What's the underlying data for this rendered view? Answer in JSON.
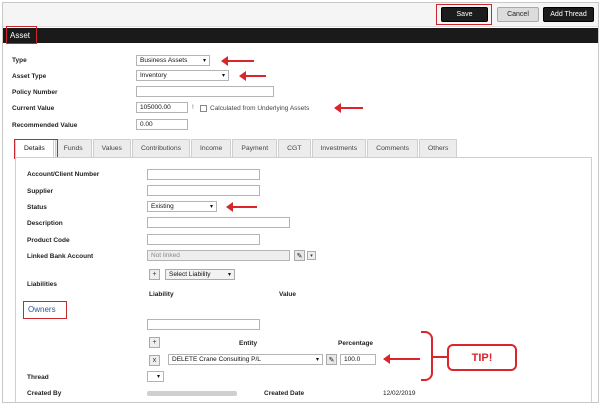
{
  "toolbar": {
    "save_label": "Save",
    "cancel_label": "Cancel",
    "add_thread_label": "Add Thread"
  },
  "section": {
    "title": "Asset"
  },
  "form": {
    "type_label": "Type",
    "type_value": "Business Assets",
    "asset_type_label": "Asset Type",
    "asset_type_value": "Inventory",
    "policy_number_label": "Policy Number",
    "policy_number_value": "",
    "current_value_label": "Current Value",
    "current_value_value": "105000.00",
    "current_value_marker": "!",
    "calculated_label": "Calculated from Underlying Assets",
    "recommended_value_label": "Recommended Value",
    "recommended_value_value": "0.00"
  },
  "tabs": [
    "Details",
    "Funds",
    "Values",
    "Contributions",
    "Income",
    "Payment",
    "CGT",
    "Investments",
    "Comments",
    "Others"
  ],
  "details": {
    "account_label": "Account/Client Number",
    "account_value": "",
    "supplier_label": "Supplier",
    "supplier_value": "",
    "status_label": "Status",
    "status_value": "Existing",
    "description_label": "Description",
    "description_value": "",
    "product_code_label": "Product Code",
    "product_code_value": "",
    "linked_bank_label": "Linked Bank Account",
    "linked_bank_value": "Not linked",
    "select_liability_label": "Select Liability",
    "liabilities_label": "Liabilities",
    "liability_col": "Liability",
    "value_col": "Value",
    "owners_label": "Owners",
    "entity_col": "Entity",
    "percentage_col": "Percentage",
    "owner_entity_value": "DELETE Crane Consulting P/L",
    "owner_percentage_value": "100.0",
    "thread_label": "Thread",
    "created_by_label": "Created By",
    "created_date_label": "Created Date",
    "created_date_value": "12/02/2019"
  },
  "icons": {
    "caret": "▾",
    "plus": "+",
    "remove": "x",
    "pencil": "✎"
  },
  "callout": {
    "tip_label": "TIP!"
  },
  "colors": {
    "annotation_red": "#d9252b",
    "header_black": "#1a1a1a",
    "owners_blue": "#2b5797"
  }
}
